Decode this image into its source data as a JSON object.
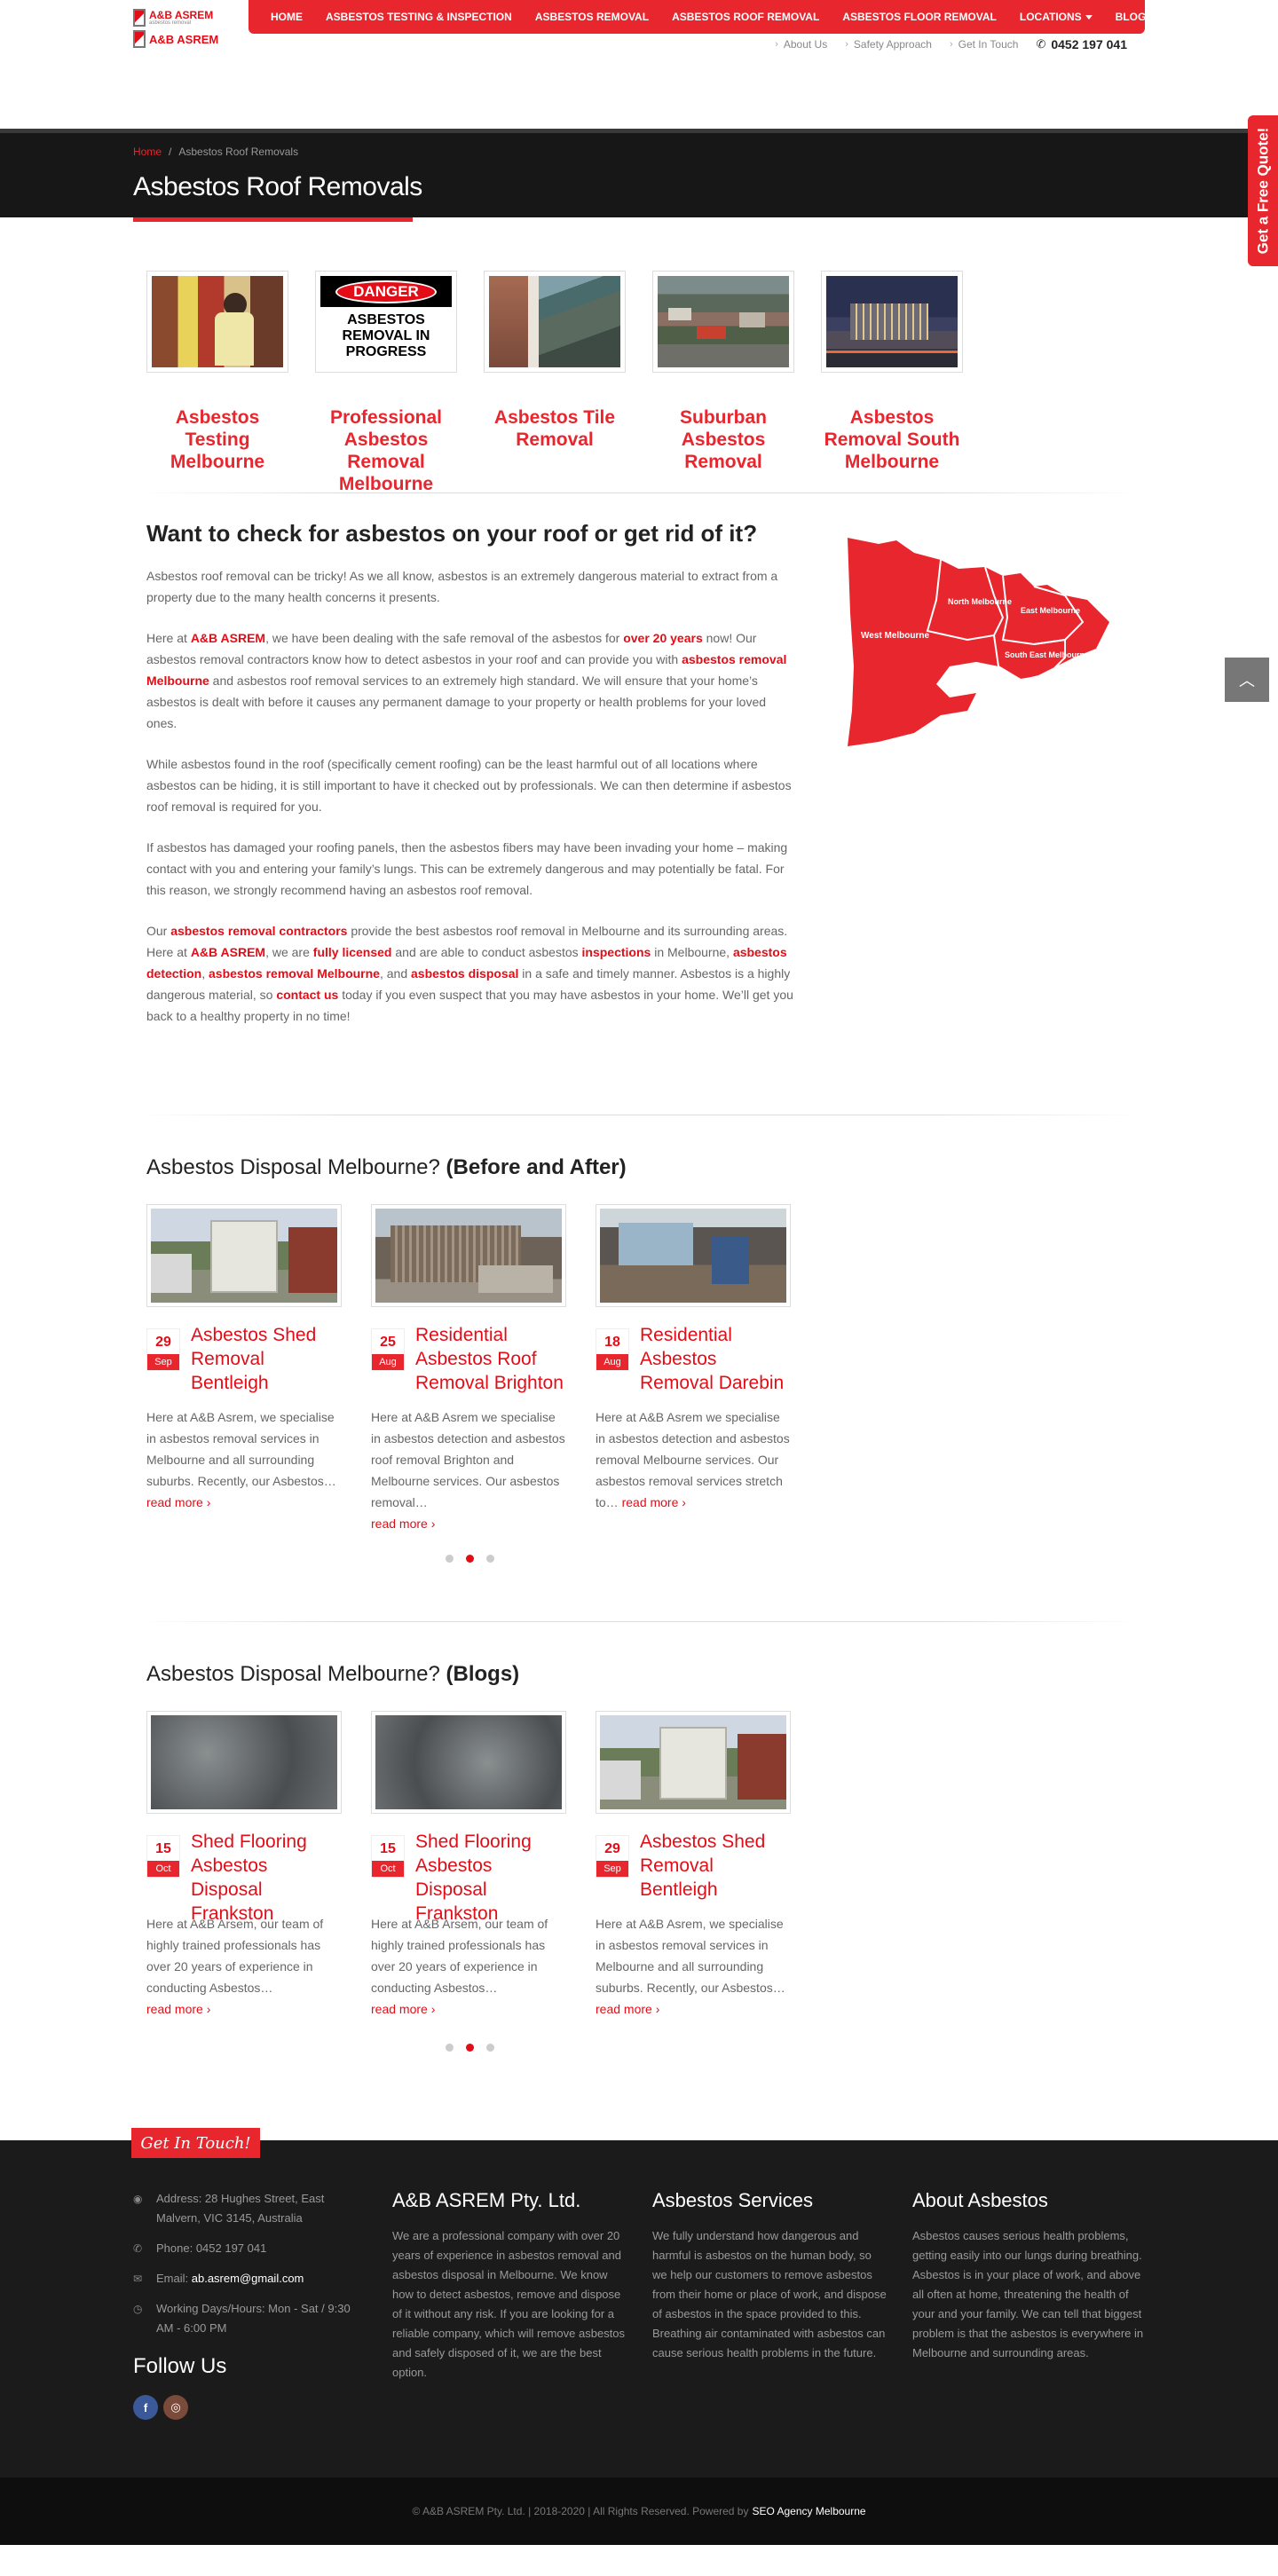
{
  "header": {
    "logo_text": "A&B ASREM",
    "logo_tagline": "asbestos removal",
    "nav": [
      "HOME",
      "ASBESTOS TESTING & INSPECTION",
      "ASBESTOS REMOVAL",
      "ASBESTOS ROOF REMOVAL",
      "ASBESTOS FLOOR REMOVAL",
      "LOCATIONS",
      "BLOG"
    ],
    "topbar": {
      "about": "About Us",
      "safety": "Safety Approach",
      "contact": "Get In Touch",
      "phone": "0452 197 041"
    }
  },
  "titlebar": {
    "breadcrumb_home": "Home",
    "breadcrumb_sep": "/",
    "breadcrumb_current": "Asbestos Roof Removals",
    "title": "Asbestos Roof Removals"
  },
  "quote_tab": "Get a Free Quote!",
  "services": [
    {
      "title": "Asbestos Testing Melbourne"
    },
    {
      "title": "Professional Asbestos Removal Melbourne",
      "sign_top": "DANGER",
      "sign_text": "ASBESTOS REMOVAL IN PROGRESS"
    },
    {
      "title": "Asbestos Tile Removal"
    },
    {
      "title": "Suburban Asbestos Removal"
    },
    {
      "title": "Asbestos Removal South Melbourne"
    }
  ],
  "intro": {
    "heading": "Want to check for asbestos on your roof or get rid of it?",
    "p1": "Asbestos roof removal can be tricky! As we all know, asbestos is an extremely dangerous material to extract from a property due to the many health concerns it presents.",
    "p2": {
      "a": "Here at ",
      "b": "A&B ASREM",
      "c": ", we have been dealing with the safe removal of the asbestos for ",
      "d": "over 20 years",
      "e": " now! Our asbestos removal contractors know how to detect asbestos in your roof and can provide you with ",
      "f": "asbestos removal Melbourne",
      "g": " and asbestos roof removal services to an extremely high standard. We will ensure that your home’s asbestos is dealt with before it causes any permanent damage to your property or health problems for your loved ones."
    },
    "p3": "While asbestos found in the roof (specifically cement roofing) can be the least harmful out of all locations where asbestos can be hiding, it is still important to have it checked out by professionals. We can then determine if asbestos roof removal is required for you.",
    "p4": "If asbestos has damaged your roofing panels, then the asbestos fibers may have been invading your home – making contact with you and entering your family’s lungs. This can be extremely dangerous and may potentially be fatal. For this reason, we strongly recommend having an asbestos roof removal.",
    "p5": {
      "a": "Our ",
      "b": "asbestos removal contractors",
      "c": " provide the best asbestos roof removal in Melbourne and its surrounding areas. Here at ",
      "d": "A&B ASREM",
      "e": ", we are ",
      "f": "fully licensed",
      "g": " and are able to conduct asbestos ",
      "h": "inspections",
      "i": " in Melbourne, ",
      "j": "asbestos detection",
      "k": ", ",
      "l": "asbestos removal Melbourne",
      "m": ", and ",
      "n": "asbestos disposal",
      "o": " in a safe and timely manner. Asbestos is a highly dangerous material, so ",
      "p": "contact us",
      "q": " today if you even suspect that you may have asbestos in your home. We’ll get you back to a healthy property in no time!"
    },
    "map_labels": {
      "west": "West Melbourne",
      "north": "North Melbourne",
      "east": "East Melbourne",
      "southeast": "South East Melbourne"
    }
  },
  "before_after": {
    "heading": "Asbestos Disposal Melbourne?",
    "heading_bold": "(Before and After)",
    "posts": [
      {
        "day": "29",
        "month": "Sep",
        "title": "Asbestos Shed Removal Bentleigh",
        "excerpt": "Here at A&B Asrem, we specialise in asbestos removal services in Melbourne and all surrounding suburbs. Recently, our Asbestos…",
        "more": "read more ›"
      },
      {
        "day": "25",
        "month": "Aug",
        "title": "Residential Asbestos Roof Removal Brighton",
        "excerpt": "Here at A&B Asrem we specialise in asbestos detection and asbestos roof removal Brighton and Melbourne services. Our asbestos removal…",
        "more": "read more ›"
      },
      {
        "day": "18",
        "month": "Aug",
        "title": "Residential Asbestos Removal Darebin",
        "excerpt": "Here at A&B Asrem we specialise in asbestos detection and asbestos removal Melbourne services. Our asbestos removal services stretch to…",
        "more": "read more ›"
      }
    ]
  },
  "blogs": {
    "heading": "Asbestos Disposal Melbourne?",
    "heading_bold": "(Blogs)",
    "posts": [
      {
        "day": "15",
        "month": "Oct",
        "title": "Shed Flooring Asbestos Disposal Frankston",
        "excerpt": "Here at A&B Arsem, our team of highly trained professionals has over 20 years of experience in conducting Asbestos…",
        "more": "read more ›"
      },
      {
        "day": "15",
        "month": "Oct",
        "title": "Shed Flooring Asbestos Disposal Frankston",
        "excerpt": "Here at A&B Arsem, our team of highly trained professionals has over 20 years of experience in conducting Asbestos…",
        "more": "read more ›"
      },
      {
        "day": "29",
        "month": "Sep",
        "title": "Asbestos Shed Removal Bentleigh",
        "excerpt": "Here at A&B Asrem, we specialise in asbestos removal services in Melbourne and all surrounding suburbs. Recently, our Asbestos…",
        "more": "read more ›"
      }
    ]
  },
  "footer": {
    "tab": "Get In Touch!",
    "address": "Address: 28 Hughes Street, East Malvern, VIC 3145, Australia",
    "phone": "Phone: 0452 197 041",
    "email_label": "Email:",
    "email": "ab.asrem@gmail.com",
    "hours": "Working Days/Hours: Mon - Sat / 9:30 AM - 6:00 PM",
    "follow": "Follow Us",
    "col1_title": "A&B ASREM Pty. Ltd.",
    "col1_text": "We are a professional company with over 20 years of experience in asbestos removal and asbestos disposal in Melbourne. We know how to detect asbestos, remove and dispose of it without any risk. If you are looking for a reliable company, which will remove asbestos and safely disposed of it, we are the best option.",
    "col2_title": "Asbestos Services",
    "col2_text": "We fully understand how dangerous and harmful is asbestos on the human body, so we help our customers to remove asbestos from their home or place of work, and dispose of asbestos in the space provided to this. Breathing air contaminated with asbestos can cause serious health problems in the future.",
    "col3_title": "About Asbestos",
    "col3_text": "Asbestos causes serious health problems, getting easily into our lungs during breathing. Asbestos is in your place of work, and above all often at home, threatening the health of your and your family. We can tell that biggest problem is that the asbestos is everywhere in Melbourne and surrounding areas.",
    "copyright": "© A&B ASREM Pty. Ltd. | 2018-2020 | All Rights Reserved. Powered by",
    "powered_by": "SEO Agency Melbourne"
  },
  "colors": {
    "accent": "#e8262e",
    "dark": "#171717",
    "footer": "#1b1b1b"
  },
  "icons": [
    "phone-icon",
    "map-marker-icon",
    "email-icon",
    "clock-icon",
    "facebook-icon",
    "instagram-icon",
    "chevron-up-icon",
    "caret-down-icon"
  ]
}
